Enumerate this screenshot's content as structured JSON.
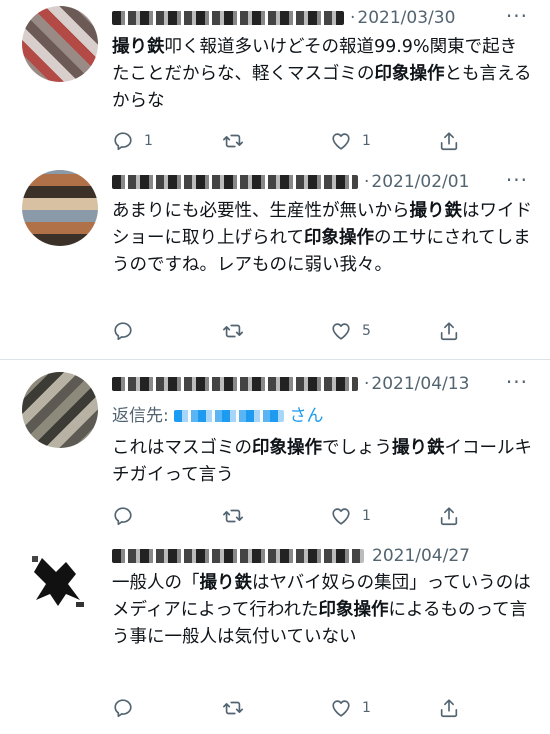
{
  "tweets": [
    {
      "date": "2021/03/30",
      "separator": "·",
      "more": "···",
      "reply_to": null,
      "segments": [
        {
          "text": "撮り鉄",
          "bold": true
        },
        {
          "text": "叩く報道多いけどその報道99.9%関東で起きたことだからな、軽くマスゴミの",
          "bold": false
        },
        {
          "text": "印象操作",
          "bold": true
        },
        {
          "text": "とも言えるからな",
          "bold": false
        }
      ],
      "reply_count": "1",
      "retweet_count": "",
      "like_count": "1"
    },
    {
      "date": "2021/02/01",
      "separator": "·",
      "more": "···",
      "reply_to": null,
      "segments": [
        {
          "text": "あまりにも必要性、生産性が無いから",
          "bold": false
        },
        {
          "text": "撮り鉄",
          "bold": true
        },
        {
          "text": "はワイドショーに取り上げられて",
          "bold": false
        },
        {
          "text": "印象操作",
          "bold": true
        },
        {
          "text": "のエサにされてしまうのですね。レアものに弱い我々。",
          "bold": false
        }
      ],
      "reply_count": "",
      "retweet_count": "",
      "like_count": "5"
    },
    {
      "date": "2021/04/13",
      "separator": "·",
      "more": "···",
      "reply_to": {
        "prefix": "返信先:",
        "suffix": "さん"
      },
      "segments": [
        {
          "text": "これはマスゴミの",
          "bold": false
        },
        {
          "text": "印象操作",
          "bold": true
        },
        {
          "text": "でしょう",
          "bold": false
        },
        {
          "text": "撮り鉄",
          "bold": true
        },
        {
          "text": "イコールキチガイって言う",
          "bold": false
        }
      ],
      "reply_count": "",
      "retweet_count": "",
      "like_count": "1"
    },
    {
      "date": "2021/04/27",
      "separator": "",
      "more": "",
      "reply_to": null,
      "segments": [
        {
          "text": "一般人の「",
          "bold": false
        },
        {
          "text": "撮り鉄",
          "bold": true
        },
        {
          "text": "はヤバイ奴らの集団」っていうのはメディアによって行われた",
          "bold": false
        },
        {
          "text": "印象操作",
          "bold": true
        },
        {
          "text": "によるものって言う事に一般人は気付いていない",
          "bold": false
        }
      ],
      "reply_count": "",
      "retweet_count": "",
      "like_count": "1"
    }
  ],
  "icons": {
    "reply": "reply-icon",
    "retweet": "retweet-icon",
    "like": "like-icon",
    "share": "share-icon"
  },
  "colors": {
    "text": "#0f1419",
    "muted": "#536471",
    "link": "#1d9bf0",
    "divider": "#dde2e6"
  }
}
